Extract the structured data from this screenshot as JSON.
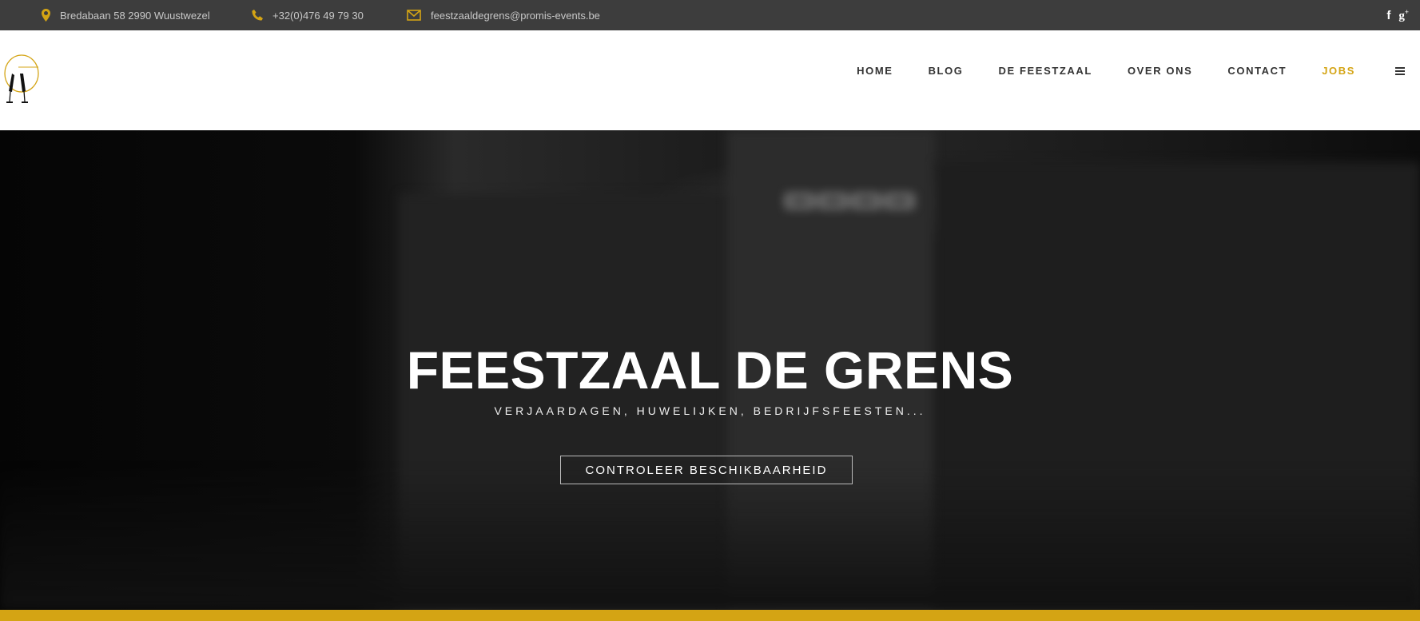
{
  "topbar": {
    "address": "Bredabaan 58 2990 Wuustwezel",
    "phone": "+32(0)476 49 79 30",
    "email": "feestzaaldegrens@promis-events.be",
    "social": [
      "facebook",
      "google-plus"
    ]
  },
  "nav": {
    "items": [
      {
        "label": "HOME"
      },
      {
        "label": "BLOG"
      },
      {
        "label": "DE FEESTZAAL"
      },
      {
        "label": "OVER ONS"
      },
      {
        "label": "CONTACT"
      },
      {
        "label": "JOBS"
      }
    ]
  },
  "hero": {
    "title": "FEESTZAAL DE GRENS",
    "subtitle": "VERJAARDAGEN, HUWELIJKEN, BEDRIJFSFEESTEN...",
    "cta": "CONTROLEER BESCHIKBAARHEID"
  },
  "colors": {
    "accent": "#d4a414",
    "topbar": "#3d3d3d"
  }
}
